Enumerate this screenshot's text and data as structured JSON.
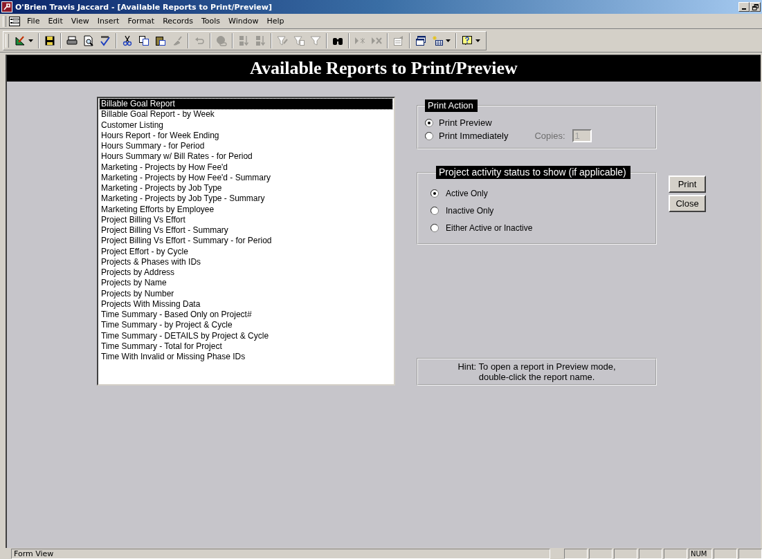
{
  "window": {
    "title": "O'Brien Travis Jaccard - [Available Reports to Print/Preview]"
  },
  "menu_bar": {
    "items": [
      {
        "label": "File"
      },
      {
        "label": "Edit"
      },
      {
        "label": "View"
      },
      {
        "label": "Insert"
      },
      {
        "label": "Format"
      },
      {
        "label": "Records"
      },
      {
        "label": "Tools"
      },
      {
        "label": "Window"
      },
      {
        "label": "Help"
      }
    ]
  },
  "toolbar": [
    {
      "kind": "view",
      "disabled": false,
      "dropdown": true
    },
    {
      "kind": "sep"
    },
    {
      "kind": "save",
      "disabled": false
    },
    {
      "kind": "sep"
    },
    {
      "kind": "print",
      "disabled": false
    },
    {
      "kind": "preview",
      "disabled": false
    },
    {
      "kind": "spelling",
      "disabled": false
    },
    {
      "kind": "sep"
    },
    {
      "kind": "cut",
      "disabled": false
    },
    {
      "kind": "copy",
      "disabled": false
    },
    {
      "kind": "paste",
      "disabled": false
    },
    {
      "kind": "brush",
      "disabled": true
    },
    {
      "kind": "sep"
    },
    {
      "kind": "undo",
      "disabled": true
    },
    {
      "kind": "sep"
    },
    {
      "kind": "globe",
      "disabled": true
    },
    {
      "kind": "sep"
    },
    {
      "kind": "sort-asc",
      "disabled": true
    },
    {
      "kind": "sort-desc",
      "disabled": true
    },
    {
      "kind": "sep"
    },
    {
      "kind": "filter-selection",
      "disabled": true
    },
    {
      "kind": "filter-form",
      "disabled": true
    },
    {
      "kind": "filter",
      "disabled": true
    },
    {
      "kind": "sep"
    },
    {
      "kind": "find",
      "disabled": false
    },
    {
      "kind": "sep"
    },
    {
      "kind": "new-record",
      "disabled": true
    },
    {
      "kind": "delete-record",
      "disabled": true
    },
    {
      "kind": "sep"
    },
    {
      "kind": "properties",
      "disabled": true
    },
    {
      "kind": "sep"
    },
    {
      "kind": "database",
      "disabled": false
    },
    {
      "kind": "new-object",
      "disabled": false,
      "dropdown": true
    },
    {
      "kind": "sep"
    },
    {
      "kind": "help",
      "disabled": false,
      "dropdown": true
    }
  ],
  "header": {
    "title": "Available Reports to Print/Preview"
  },
  "reports": [
    {
      "label": "Billable Goal Report",
      "selected": true
    },
    {
      "label": "Billable Goal Report - by Week",
      "selected": false
    },
    {
      "label": "Customer Listing",
      "selected": false
    },
    {
      "label": "Hours Report - for Week Ending",
      "selected": false
    },
    {
      "label": "Hours Summary - for Period",
      "selected": false
    },
    {
      "label": "Hours Summary w/ Bill Rates - for Period",
      "selected": false
    },
    {
      "label": "Marketing - Projects by How Fee'd",
      "selected": false
    },
    {
      "label": "Marketing - Projects by How Fee'd - Summary",
      "selected": false
    },
    {
      "label": "Marketing - Projects by Job Type",
      "selected": false
    },
    {
      "label": "Marketing - Projects by Job Type - Summary",
      "selected": false
    },
    {
      "label": "Marketing Efforts by Employee",
      "selected": false
    },
    {
      "label": "Project Billing Vs Effort",
      "selected": false
    },
    {
      "label": "Project Billing Vs Effort - Summary",
      "selected": false
    },
    {
      "label": "Project Billing Vs Effort - Summary - for Period",
      "selected": false
    },
    {
      "label": "Project Effort - by Cycle",
      "selected": false
    },
    {
      "label": "Projects & Phases with IDs",
      "selected": false
    },
    {
      "label": "Projects by Address",
      "selected": false
    },
    {
      "label": "Projects by Name",
      "selected": false
    },
    {
      "label": "Projects by Number",
      "selected": false
    },
    {
      "label": "Projects With Missing Data",
      "selected": false
    },
    {
      "label": "Time Summary - Based Only on Project#",
      "selected": false
    },
    {
      "label": "Time Summary - by Project & Cycle",
      "selected": false
    },
    {
      "label": "Time Summary - DETAILS by Project & Cycle",
      "selected": false
    },
    {
      "label": "Time Summary - Total for Project",
      "selected": false
    },
    {
      "label": "Time With Invalid or Missing Phase IDs",
      "selected": false
    }
  ],
  "print_action": {
    "title": "Print Action",
    "options": [
      {
        "label": "Print Preview",
        "selected": true
      },
      {
        "label": "Print Immediately",
        "selected": false
      }
    ],
    "copies": {
      "label": "Copies:",
      "value": "1",
      "disabled": true
    }
  },
  "activity_status": {
    "title": "Project activity status to show (if applicable)",
    "options": [
      {
        "label": "Active Only",
        "selected": true
      },
      {
        "label": "Inactive Only",
        "selected": false
      },
      {
        "label": "Either Active or Inactive",
        "selected": false
      }
    ]
  },
  "buttons": [
    {
      "label": "Print"
    },
    {
      "label": "Close"
    }
  ],
  "hint": "Hint: To open a report in Preview mode, double-click the report name.",
  "status_bar": {
    "text": "Form View",
    "indicators": [
      {
        "text": "NUM"
      }
    ]
  }
}
